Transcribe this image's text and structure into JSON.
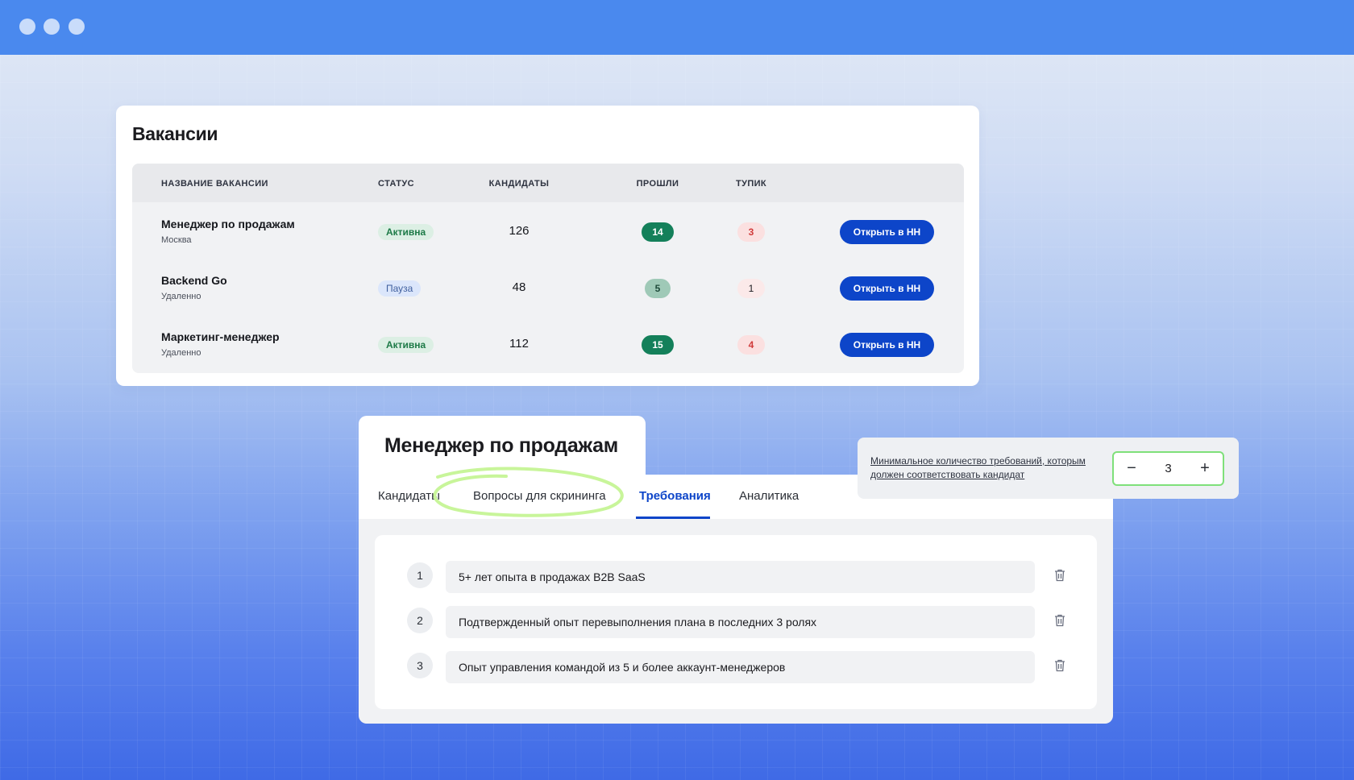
{
  "vacancies": {
    "title": "Вакансии",
    "columns": {
      "name": "НАЗВАНИЕ ВАКАНСИИ",
      "status": "СТАТУС",
      "candidates": "КАНДИДАТЫ",
      "passed": "ПРОШЛИ",
      "dead_end": "ТУПИК"
    },
    "rows": [
      {
        "name": "Менеджер по продажам",
        "location": "Москва",
        "status": "Активна",
        "status_kind": "active",
        "candidates": "126",
        "passed": "14",
        "dead_end": "3",
        "action": "Открыть в HH"
      },
      {
        "name": "Backend Go",
        "location": "Удаленно",
        "status": "Пауза",
        "status_kind": "pause",
        "candidates": "48",
        "passed": "5",
        "dead_end": "1",
        "action": "Открыть в HH"
      },
      {
        "name": "Маркетинг-менеджер",
        "location": "Удаленно",
        "status": "Активна",
        "status_kind": "active",
        "candidates": "112",
        "passed": "15",
        "dead_end": "4",
        "action": "Открыть в HH"
      }
    ]
  },
  "vacancy_detail": {
    "title": "Менеджер по продажам",
    "tabs": [
      {
        "label": "Кандидаты",
        "active": false
      },
      {
        "label": "Вопросы для скрининга",
        "active": false,
        "highlighted": true
      },
      {
        "label": "Требования",
        "active": true
      },
      {
        "label": "Аналитика",
        "active": false
      }
    ],
    "requirements": [
      {
        "number": "1",
        "text": "5+ лет опыта в продажах B2B SaaS"
      },
      {
        "number": "2",
        "text": "Подтвержденный опыт перевыполнения плана в последних 3 ролях"
      },
      {
        "number": "3",
        "text": "Опыт управления командой из 5 и более аккаунт-менеджеров"
      }
    ]
  },
  "min_requirements": {
    "label": "Минимальное количество требований, которым должен соответствовать кандидат",
    "minus": "−",
    "value": "3",
    "plus": "+"
  },
  "icons": {
    "window_dots": "dot-icon",
    "delete": "trash-icon"
  },
  "colors": {
    "accent": "#0d45c9",
    "success": "#14805a",
    "danger": "#d03a3a",
    "highlight": "#c8f59a"
  }
}
